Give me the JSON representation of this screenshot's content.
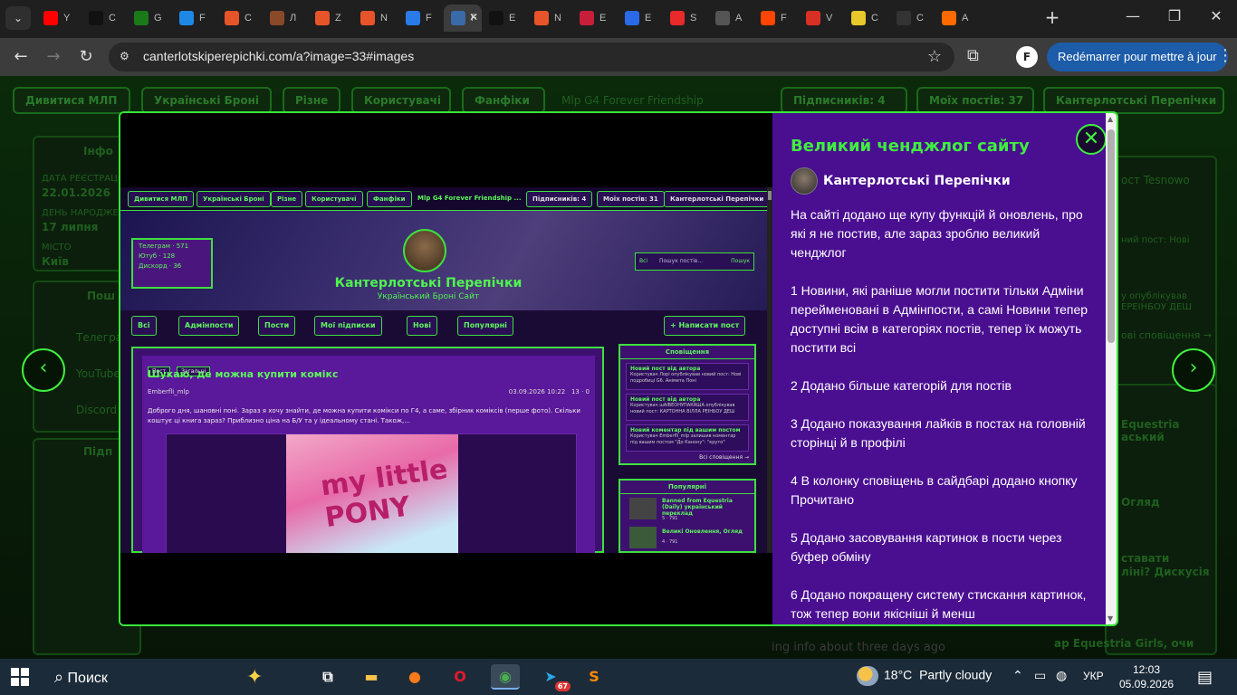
{
  "browser": {
    "tabs": [
      {
        "favicon": "youtube-icon",
        "color": "#ff0000",
        "label": "Y"
      },
      {
        "favicon": "openai-icon",
        "color": "#111111",
        "label": "C"
      },
      {
        "favicon": "game-icon",
        "color": "#1a7a1a",
        "label": "G"
      },
      {
        "favicon": "hq-icon",
        "color": "#1e88e5",
        "label": "F"
      },
      {
        "favicon": "mlp-icon",
        "color": "#e8542a",
        "label": "C"
      },
      {
        "favicon": "pony-icon",
        "color": "#8a4a2a",
        "label": "Л"
      },
      {
        "favicon": "mlp-icon",
        "color": "#e8542a",
        "label": "Z"
      },
      {
        "favicon": "mlp-icon",
        "color": "#e8542a",
        "label": "N"
      },
      {
        "favicon": "pony-icon",
        "color": "#2a7ae8",
        "label": "F"
      },
      {
        "favicon": "image-icon",
        "color": "#3a6aa8",
        "label": "F"
      },
      {
        "favicon": "openai-icon",
        "color": "#111111",
        "label": "E"
      },
      {
        "favicon": "sparkle-icon",
        "color": "#e8542a",
        "label": "N"
      },
      {
        "favicon": "tube-icon",
        "color": "#c81e3a",
        "label": "E"
      },
      {
        "favicon": "chart-icon",
        "color": "#2a6ae8",
        "label": "E"
      },
      {
        "favicon": "g-icon",
        "color": "#e82a2a",
        "label": "S"
      },
      {
        "favicon": "hd-icon",
        "color": "#555555",
        "label": "A"
      },
      {
        "favicon": "reddit-icon",
        "color": "#ff4500",
        "label": "F"
      },
      {
        "favicon": "gmail-icon",
        "color": "#d93025",
        "label": "V"
      },
      {
        "favicon": "pony-icon",
        "color": "#e8c82a",
        "label": "C"
      },
      {
        "favicon": "clapper-icon",
        "color": "#333333",
        "label": "C"
      },
      {
        "favicon": "orange-icon",
        "color": "#ff6a00",
        "label": "A"
      }
    ],
    "url": "canterlotskiperepichki.com/a?image=33#images",
    "update_label": "Redémarrer pour mettre à jour",
    "profile_letter": "F"
  },
  "background_page": {
    "nav": [
      "Дивитися МЛП",
      "Українські Броні",
      "Різне",
      "Користувачі",
      "Фанфіки",
      "Mlp G4 Forever Friendship",
      "Підписників: 4",
      "Моїх постів: 37",
      "Кантерлотські Перепічки"
    ],
    "left": {
      "info_title": "Інфо",
      "reg_label": "ДАТА РЕЄСТРАЦІЇ",
      "reg_date": "22.01.2026",
      "birthday_label": "ДЕНЬ НАРОДЖЕННЯ",
      "birthday": "17 липня",
      "city_label": "МІСТО",
      "city": "Київ",
      "socials_title": "Пош",
      "telegram": "Телеграм",
      "youtube": "YouTube",
      "discord": "Discord",
      "subs_title": "Підп"
    },
    "right": {
      "r1": "ост Tesnowo",
      "r2": "ний пост: Нові",
      "r3": "у опублікував",
      "r4": "ЕРЕІНБОУ ДЕШ",
      "r5": "ові сповіщення →",
      "r6": "Equestria",
      "r7": "аський",
      "r8": "ставати",
      "r9": "ліні? Дискусія",
      "r10": "Великі Оновлення, Огляд",
      "r11": "Огляд",
      "r12": "ing info about three days ago",
      "r13": "ing info about three days ago",
      "r14": "ар Equestria Girls, очи"
    }
  },
  "modal": {
    "screenshot": {
      "nav": [
        "Дивитися МЛП",
        "Українські Броні",
        "Різне",
        "Користувачі",
        "Фанфіки",
        "Mlp G4 Forever Friendship ...",
        "Підписників: 4",
        "Моїх постів: 31",
        "Кантерлотські Перепічки"
      ],
      "socials": [
        "Телеграм · 571",
        "Ютуб · 128",
        "Дискорд · 36"
      ],
      "site_title": "Кантерлотські Перепічки",
      "site_subtitle": "Український Броні Сайт",
      "search_scope": "Всі",
      "search_placeholder": "Пошук постів...",
      "search_button": "Пошук",
      "menu": [
        "Всі",
        "Адмінпости",
        "Пости",
        "Мої підписки",
        "Нові",
        "Популярні",
        "+ Написати пост"
      ],
      "post": {
        "tags": [
          "Пост",
          "Загальні"
        ],
        "title": "Шукаю, де можна купити комікс",
        "author": "Emberfli_mlp",
        "date": "03.09.2026 10:22",
        "stats": "13 · 0",
        "text": "Доброго дня, шановні поні. Зараз я хочу знайти, де можна купити комікси по Г4, а саме, збірник коміксів (перше фото). Скільки коштує ці книга зараз? Приблизно ціна на Б/У та у ідеальному стані. Також,...",
        "comic_text": "my little PONY"
      },
      "notifications": {
        "title": "Сповіщення",
        "items": [
          {
            "head": "Новий пост від автора",
            "body": "Користувач Лорі опублікував новий пост: Нові подробиці G6. Анімета Поні"
          },
          {
            "head": "Новий пост від автора",
            "body": "Користувач шАІВЕОНУПАКАША опублікував новий пост: КАРТОННА ВІЛЛА РЕІНБОУ ДЕШ"
          },
          {
            "head": "Новий коментар під вашим постом",
            "body": "Користувач Emberfli_mlp залишив коментар під вашим постом \"До Канону\": \"круто\""
          }
        ],
        "all": "Всі сповіщення →"
      },
      "popular": {
        "title": "Популярні",
        "items": [
          {
            "title": "Banned from Equestria (Daily) український переклад",
            "stats": "5 · 791"
          },
          {
            "title": "Великі Оновлення, Огляд",
            "stats": "4 · 791"
          }
        ]
      }
    },
    "post_title": "Великий ченджлог сайту",
    "author": "Кантерлотські Перепічки",
    "body": [
      "На сайті додано ще купу функцій й оновлень, про які я не постив, але зараз зроблю великий ченджлог",
      "1 Новини, які раніше могли постити тільки Адміни перейменовані в Адмінпости, а самі Новини тепер доступні всім в категоріях постів, тепер їх можуть постити всі",
      "2 Додано більше категорій для постів",
      "3 Додано показування лайків в постах на головній сторінці й в профілі",
      "4 В колонку сповіщень в сайдбарі додано кнопку Прочитано",
      "5 Додано засовування картинок в пости через буфер обміну",
      "6 Додано покращену систему стискання картинок, тож тепер вони якісніші й менш"
    ],
    "close_symbol": "✕",
    "prev_symbol": "‹",
    "next_symbol": "›"
  },
  "taskbar": {
    "search_label": "Поиск",
    "weather_temp": "18°C",
    "weather_text": "Partly cloudy",
    "language": "УКР",
    "time": "12:03",
    "date": "05.09.2026",
    "telegram_badge": "67"
  }
}
